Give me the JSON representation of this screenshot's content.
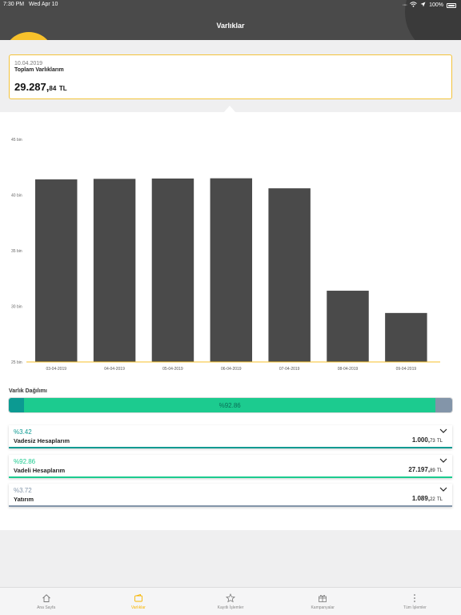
{
  "status_bar": {
    "time": "7:30 PM",
    "date": "Wed Apr 10",
    "battery": "100%"
  },
  "header": {
    "title": "Varlıklar"
  },
  "total": {
    "date": "10.04.2019",
    "label": "Toplam Varlıklarım",
    "amount_int": "29.287,",
    "amount_dec": "84",
    "currency": "TL"
  },
  "colors": {
    "accent": "#f7c12b",
    "bar": "#4a4a4a",
    "header": "#4a4a4a",
    "teal": "#0c9a92",
    "green": "#1ccb8f",
    "slate": "#8395a9"
  },
  "chart_data": {
    "type": "bar",
    "categories": [
      "03-04-2019",
      "04-04-2019",
      "05-04-2019",
      "06-04-2019",
      "07-04-2019",
      "08-04-2019",
      "09-04-2019"
    ],
    "values": [
      41400,
      41450,
      41480,
      41500,
      40600,
      31400,
      29400
    ],
    "yticks": [
      25000,
      30000,
      35000,
      40000,
      45000
    ],
    "yticklabels": [
      "25 bin",
      "30 bin",
      "35 bin",
      "40 bin",
      "45 bin"
    ],
    "ylim": [
      25000,
      45000
    ],
    "grid": false,
    "title": "",
    "xlabel": "",
    "ylabel": ""
  },
  "distribution": {
    "title": "Varlık Dağılımı",
    "center_label": "%92.86",
    "segments": [
      {
        "name": "Vadesiz Hesaplarım",
        "percent": 3.42,
        "color": "#0c9a92"
      },
      {
        "name": "Vadeli Hesaplarım",
        "percent": 92.86,
        "color": "#1ccb8f"
      },
      {
        "name": "Yatırım",
        "percent": 3.72,
        "color": "#8395a9"
      }
    ]
  },
  "accounts": [
    {
      "percent": "%3.42",
      "name": "Vadesiz Hesaplarım",
      "amount_int": "1.000,",
      "amount_dec": "73",
      "currency": "TL"
    },
    {
      "percent": "%92.86",
      "name": "Vadeli Hesaplarım",
      "amount_int": "27.197,",
      "amount_dec": "89",
      "currency": "TL"
    },
    {
      "percent": "%3.72",
      "name": "Yatırım",
      "amount_int": "1.089,",
      "amount_dec": "22",
      "currency": "TL"
    }
  ],
  "tabs": [
    {
      "label": "Ana Sayfa",
      "icon": "home-icon"
    },
    {
      "label": "Varlıklar",
      "icon": "wallet-icon",
      "active": true
    },
    {
      "label": "Kayıtlı İşlemler",
      "icon": "star-icon"
    },
    {
      "label": "Kampanyalar",
      "icon": "gift-icon"
    },
    {
      "label": "Tüm İşlemler",
      "icon": "more-icon"
    }
  ]
}
